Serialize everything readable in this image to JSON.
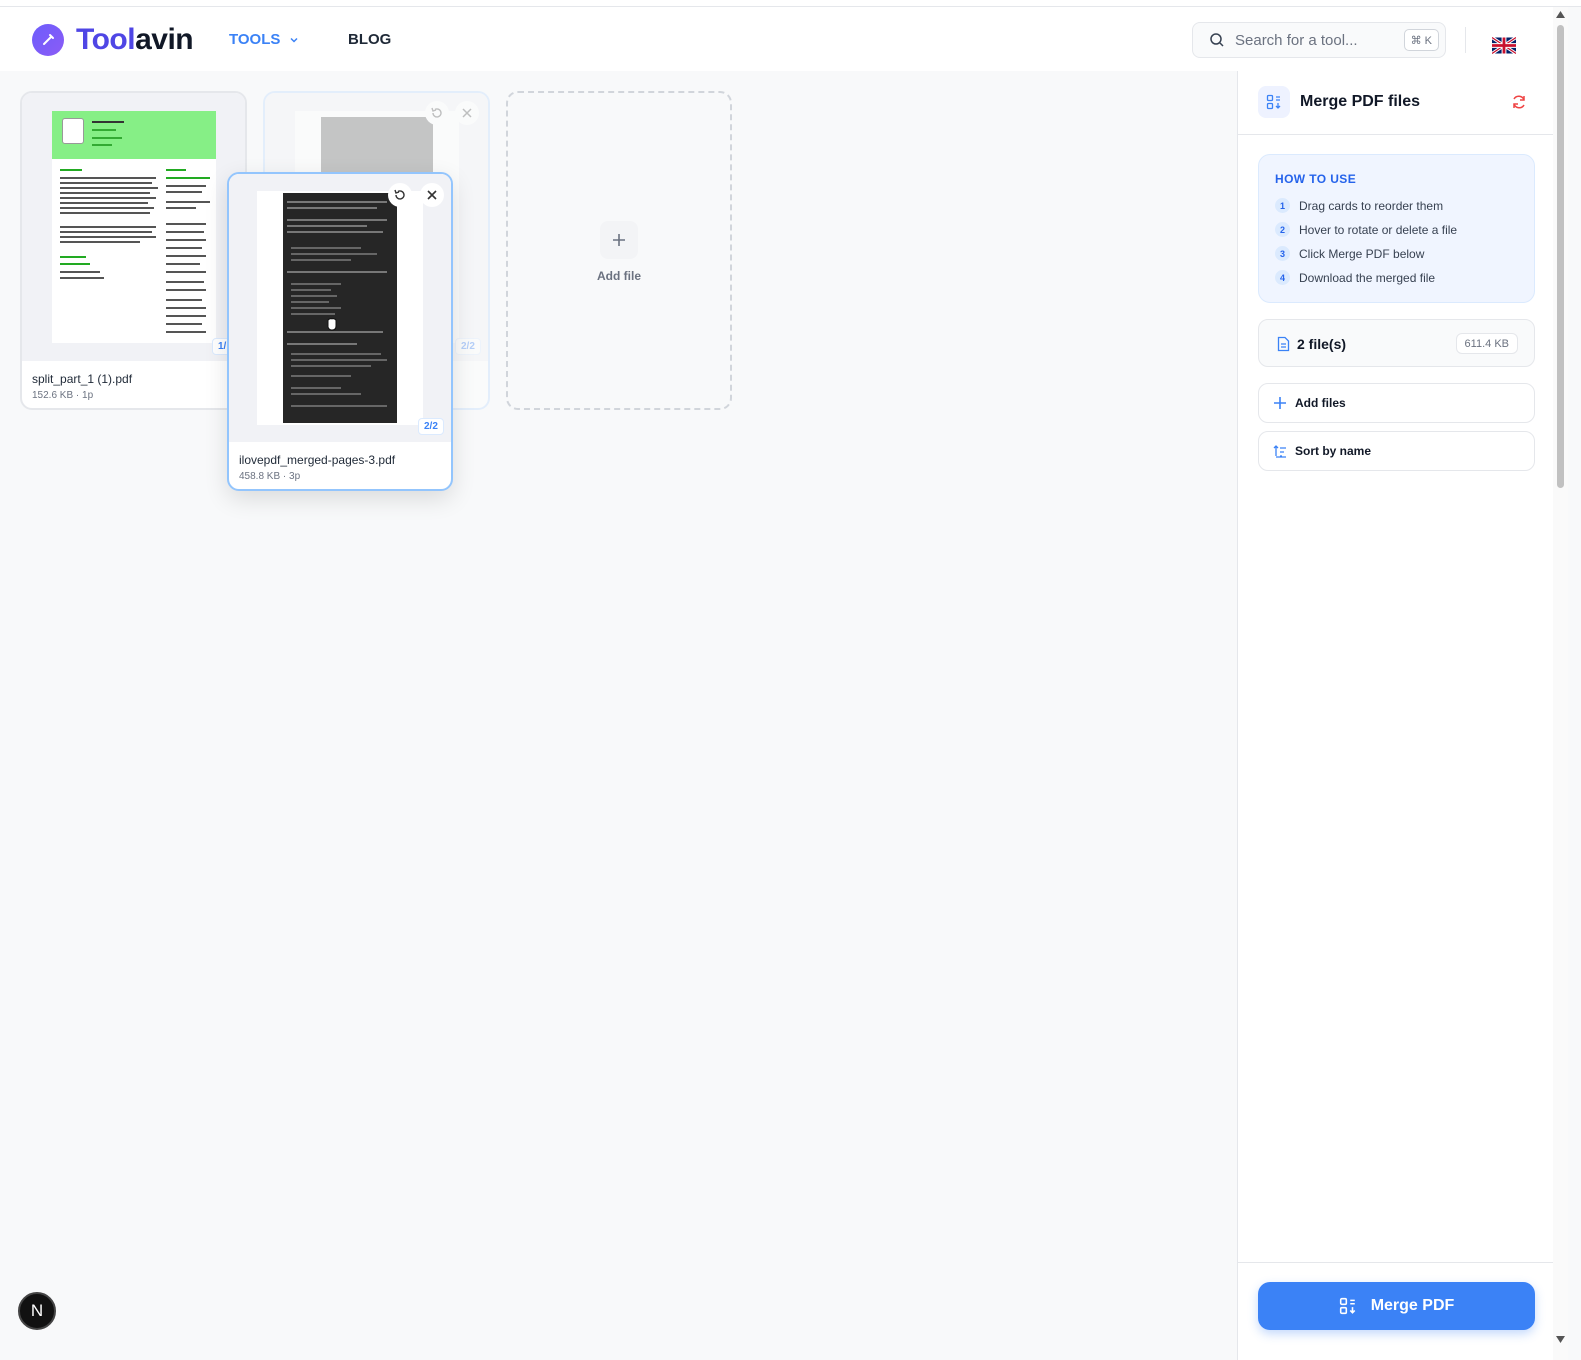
{
  "header": {
    "brand_part1": "Tool",
    "brand_part2": "avin",
    "nav_tools": "TOOLS",
    "nav_blog": "BLOG",
    "search_placeholder": "Search for a tool...",
    "search_shortcut": "⌘ K",
    "language_flag": "uk-flag-icon"
  },
  "files": [
    {
      "name": "split_part_1 (1).pdf",
      "meta": "152.6 KB · 1p",
      "badge": "1/"
    },
    {
      "name": "",
      "meta": "",
      "badge": "2/2"
    },
    {
      "name": "ilovepdf_merged-pages-3.pdf",
      "meta": "458.8 KB · 3p",
      "badge": "2/2"
    }
  ],
  "add_file_label": "Add file",
  "panel": {
    "title": "Merge PDF files",
    "howto_title": "HOW TO USE",
    "steps": [
      {
        "n": "1",
        "text": "Drag cards to reorder them"
      },
      {
        "n": "2",
        "text": "Hover to rotate or delete a file"
      },
      {
        "n": "3",
        "text": "Click Merge PDF below"
      },
      {
        "n": "4",
        "text": "Download the merged file"
      }
    ],
    "file_count": "2 file(s)",
    "total_size": "611.4 KB",
    "add_files": "Add files",
    "sort_by_name": "Sort by name",
    "merge_button": "Merge PDF"
  },
  "dev_badge": "N",
  "colors": {
    "accent": "#3b82f6",
    "brand": "#4f46e5",
    "reset": "#ef4444"
  }
}
